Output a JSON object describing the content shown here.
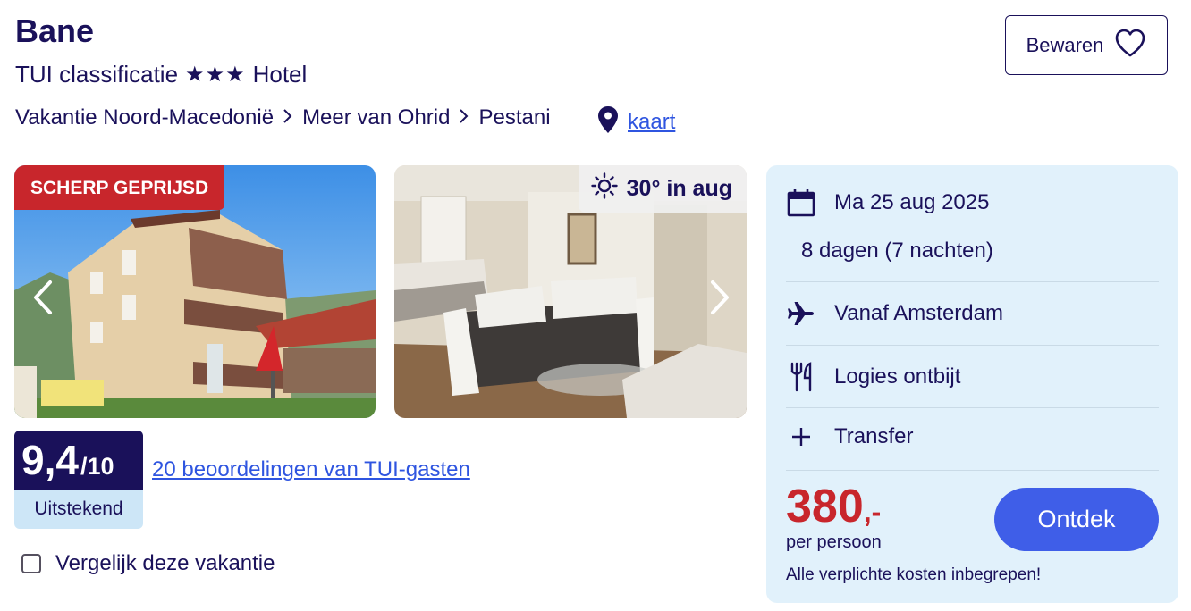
{
  "hotel": {
    "name": "Bane",
    "classification_prefix": "TUI classificatie",
    "stars": "★★★",
    "type": "Hotel"
  },
  "breadcrumb": [
    "Vakantie Noord-Macedonië",
    "Meer van Ohrid",
    "Pestani"
  ],
  "map_link_label": "kaart",
  "save_button_label": "Bewaren",
  "photos": {
    "badge": "SCHERP GEPRIJSD",
    "weather": "30° in aug"
  },
  "rating": {
    "score": "9,4",
    "scale": "/10",
    "label": "Uitstekend",
    "reviews_link": "20 beoordelingen van TUI-gasten"
  },
  "compare_label": "Vergelijk deze vakantie",
  "booking": {
    "date": "Ma 25 aug 2025",
    "duration": "8 dagen (7 nachten)",
    "departure": "Vanaf Amsterdam",
    "board": "Logies ontbijt",
    "transfer": "Transfer",
    "price": "380",
    "price_suffix": ",-",
    "per_person": "per persoon",
    "costs_note": "Alle verplichte kosten inbegrepen!",
    "cta_label": "Ontdek"
  },
  "colors": {
    "navy": "#1a115a",
    "link_blue": "#2f55e0",
    "price_red": "#c8262c",
    "panel_bg": "#e1f1fb",
    "cta_blue": "#3f5ee8"
  }
}
